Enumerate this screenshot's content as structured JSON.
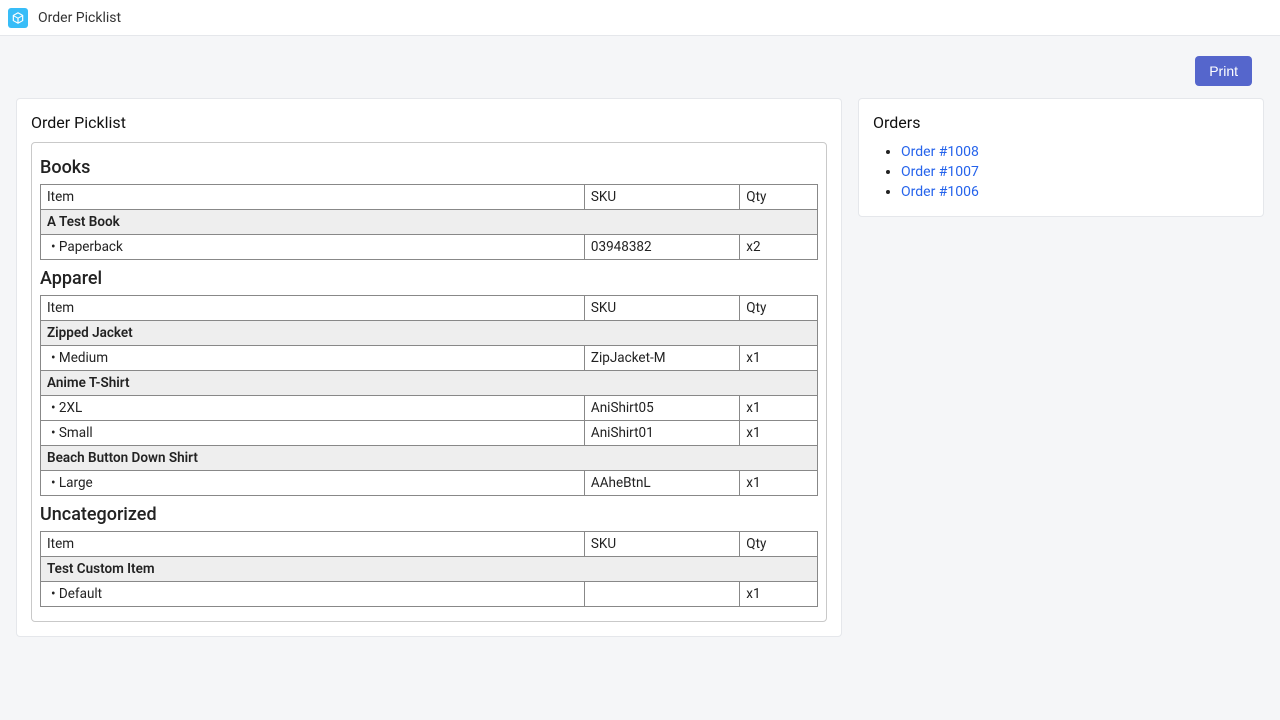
{
  "app": {
    "title": "Order Picklist"
  },
  "actions": {
    "print_label": "Print"
  },
  "picklist": {
    "title": "Order Picklist",
    "columns": {
      "item": "Item",
      "sku": "SKU",
      "qty": "Qty"
    },
    "categories": [
      {
        "name": "Books",
        "products": [
          {
            "name": "A Test Book",
            "variants": [
              {
                "name": "Paperback",
                "sku": "03948382",
                "qty": "x2"
              }
            ]
          }
        ]
      },
      {
        "name": "Apparel",
        "products": [
          {
            "name": "Zipped Jacket",
            "variants": [
              {
                "name": "Medium",
                "sku": "ZipJacket-M",
                "qty": "x1"
              }
            ]
          },
          {
            "name": "Anime T-Shirt",
            "variants": [
              {
                "name": "2XL",
                "sku": "AniShirt05",
                "qty": "x1"
              },
              {
                "name": "Small",
                "sku": "AniShirt01",
                "qty": "x1"
              }
            ]
          },
          {
            "name": "Beach Button Down Shirt",
            "variants": [
              {
                "name": "Large",
                "sku": "AAheBtnL",
                "qty": "x1"
              }
            ]
          }
        ]
      },
      {
        "name": "Uncategorized",
        "products": [
          {
            "name": "Test Custom Item",
            "variants": [
              {
                "name": "Default",
                "sku": "",
                "qty": "x1"
              }
            ]
          }
        ]
      }
    ]
  },
  "orders": {
    "title": "Orders",
    "items": [
      {
        "label": "Order #1008"
      },
      {
        "label": "Order #1007"
      },
      {
        "label": "Order #1006"
      }
    ]
  }
}
